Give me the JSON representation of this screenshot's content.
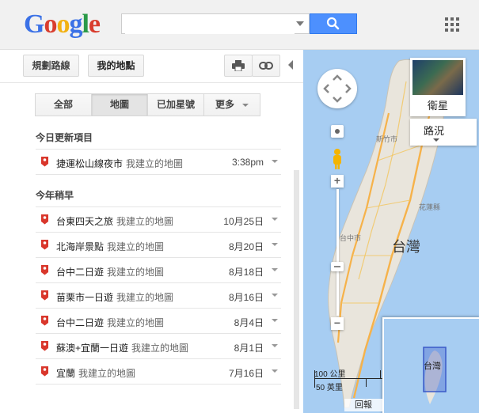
{
  "header": {
    "logo": "Google",
    "logo_colors": [
      "#3b71e6",
      "#d93d2e",
      "#f2b112",
      "#3b71e6",
      "#2b9a48",
      "#d93d2e"
    ],
    "search_value": ""
  },
  "toolbar": {
    "directions_label": "規劃路線",
    "my_places_label": "我的地點"
  },
  "filters": {
    "tabs": [
      {
        "label": "全部",
        "active": false
      },
      {
        "label": "地圖",
        "active": true
      },
      {
        "label": "已加星號",
        "active": false
      },
      {
        "label": "更多",
        "active": false
      }
    ]
  },
  "sections": {
    "today": "今日更新項目",
    "earlier": "今年稍早"
  },
  "owner_label": "我建立的地圖",
  "today_items": [
    {
      "name": "捷運松山線夜市",
      "date": "3:38pm"
    }
  ],
  "earlier_items": [
    {
      "name": "台東四天之旅",
      "date": "10月25日"
    },
    {
      "name": "北海岸景點",
      "date": "8月20日"
    },
    {
      "name": "台中二日遊",
      "date": "8月18日"
    },
    {
      "name": "苗栗市一日遊",
      "date": "8月16日"
    },
    {
      "name": "台中二日遊",
      "date": "8月4日"
    },
    {
      "name": "蘇澳+宜蘭一日遊",
      "date": "8月1日"
    },
    {
      "name": "宜蘭",
      "date": "7月16日"
    }
  ],
  "map": {
    "satellite_label": "衛星",
    "traffic_label": "路況",
    "island_label": "台灣",
    "inset_label": "台灣",
    "scale_km": "100 公里",
    "scale_mi": "50 英里",
    "back_label": "回報",
    "place_labels": [
      "新竹市",
      "台中市",
      "花蓮縣"
    ]
  },
  "colors": {
    "accent_blue": "#4d90fe",
    "pin_red": "#d9372c",
    "map_water": "#a7cdf2",
    "map_land": "#e9e5dc",
    "highway": "#f6b24a"
  }
}
